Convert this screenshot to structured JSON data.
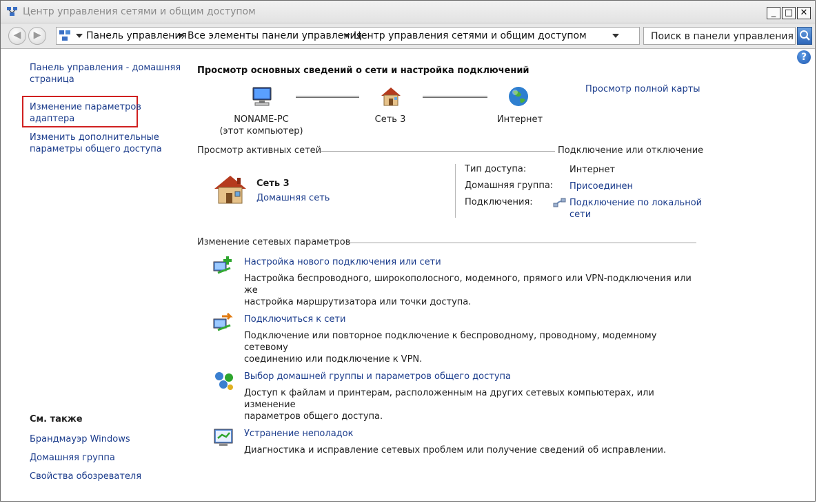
{
  "window": {
    "title": "Центр управления сетями и общим доступом",
    "buttons": {
      "minimize": "_",
      "maximize": "□",
      "close": "✕"
    }
  },
  "addressbar": {
    "back_icon": "back-arrow-icon",
    "forward_icon": "forward-arrow-icon",
    "breadcrumbs": [
      "Панель управления",
      "Все элементы панели управления",
      "Центр управления сетями и общим доступом"
    ],
    "search_placeholder": "Поиск в панели управления"
  },
  "sidebar": {
    "items": [
      {
        "label_line1": "Панель управления - домашняя",
        "label_line2": "страница"
      },
      {
        "label_line1": "Изменение параметров",
        "label_line2": "адаптера"
      },
      {
        "label_line1": "Изменить дополнительные",
        "label_line2": "параметры общего доступа"
      }
    ],
    "see_also": {
      "heading": "См. также",
      "links": [
        "Брандмауэр Windows",
        "Домашняя группа",
        "Свойства обозревателя"
      ]
    }
  },
  "main": {
    "heading": "Просмотр основных сведений о сети и настройка подключений",
    "full_map_link": "Просмотр полной карты",
    "map": {
      "computer_line1": "NONAME-PC",
      "computer_line2": "(этот компьютер)",
      "network": "Сеть  3",
      "internet": "Интернет"
    },
    "active_networks": {
      "heading": "Просмотр активных сетей",
      "connect_link": "Подключение или отключение",
      "network_name": "Сеть  3",
      "network_type": "Домашняя сеть",
      "access_type_label": "Тип доступа:",
      "access_type_value": "Интернет",
      "homegroup_label": "Домашняя группа:",
      "homegroup_value": "Присоединен",
      "connections_label": "Подключения:",
      "connection_value_line1": "Подключение по локальной",
      "connection_value_line2": "сети"
    },
    "change_settings": {
      "heading": "Изменение сетевых параметров",
      "tasks": [
        {
          "title": "Настройка нового подключения или сети",
          "desc_line1": "Настройка беспроводного, широкополосного, модемного, прямого или VPN-подключения или же",
          "desc_line2": "настройка маршрутизатора или точки доступа."
        },
        {
          "title": "Подключиться к сети",
          "desc_line1": "Подключение или повторное подключение к беспроводному, проводному, модемному сетевому",
          "desc_line2": "соединению или подключение к VPN."
        },
        {
          "title": "Выбор домашней группы и параметров общего доступа",
          "desc_line1": "Доступ к файлам и принтерам, расположенным на других сетевых компьютерах, или изменение",
          "desc_line2": "параметров общего доступа."
        },
        {
          "title": "Устранение неполадок",
          "desc_line1": "Диагностика и исправление сетевых проблем или получение сведений об исправлении.",
          "desc_line2": ""
        }
      ]
    }
  },
  "colors": {
    "link": "#1b3c8c",
    "highlight_border": "#d02020"
  }
}
